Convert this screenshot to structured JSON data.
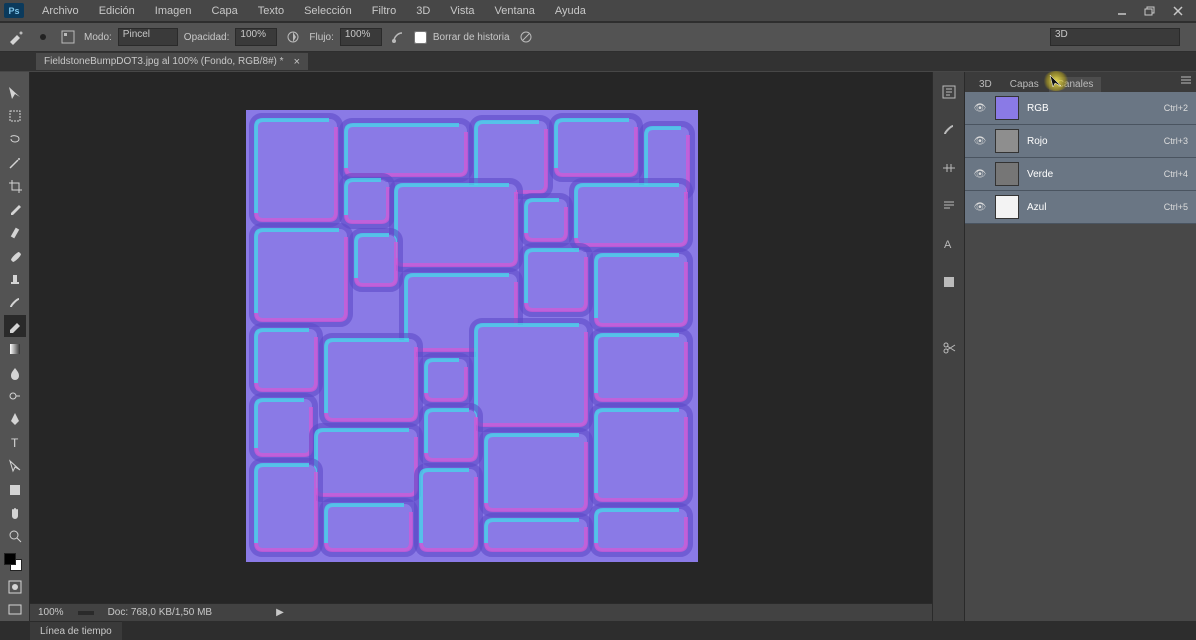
{
  "app": {
    "logo": "Ps"
  },
  "menu": {
    "archivo": "Archivo",
    "edicion": "Edición",
    "imagen": "Imagen",
    "capa": "Capa",
    "texto": "Texto",
    "seleccion": "Selección",
    "filtro": "Filtro",
    "tres_d": "3D",
    "vista": "Vista",
    "ventana": "Ventana",
    "ayuda": "Ayuda"
  },
  "options": {
    "modo_label": "Modo:",
    "modo_value": "Pincel",
    "opacidad_label": "Opacidad:",
    "opacidad_value": "100%",
    "flujo_label": "Flujo:",
    "flujo_value": "100%",
    "historia_label": "Borrar de historia",
    "workspace_selector": "3D"
  },
  "doc_tab": {
    "title": "FieldstoneBumpDOT3.jpg al 100% (Fondo, RGB/8#) *"
  },
  "panel_tabs": {
    "tres_d": "3D",
    "capas": "Capas",
    "canales": "Canales"
  },
  "channels": {
    "rgb": {
      "label": "RGB",
      "shortcut": "Ctrl+2",
      "thumb_color": "#8a7ae6"
    },
    "rojo": {
      "label": "Rojo",
      "shortcut": "Ctrl+3",
      "thumb_color": "#8e8e8e"
    },
    "verde": {
      "label": "Verde",
      "shortcut": "Ctrl+4",
      "thumb_color": "#767676"
    },
    "azul": {
      "label": "Azul",
      "shortcut": "Ctrl+5",
      "thumb_color": "#f3f3f3"
    }
  },
  "status": {
    "zoom": "100%",
    "doc_size": "Doc: 768,0 KB/1,50 MB"
  },
  "bottom_panel": {
    "label": "Línea de tiempo"
  },
  "colors": {
    "foreground": "#000000",
    "background": "#ffffff",
    "normal_map_base": "#8a7ae6",
    "normal_map_edge_l": "#48d3ea",
    "normal_map_edge_r": "#d15ad6"
  }
}
